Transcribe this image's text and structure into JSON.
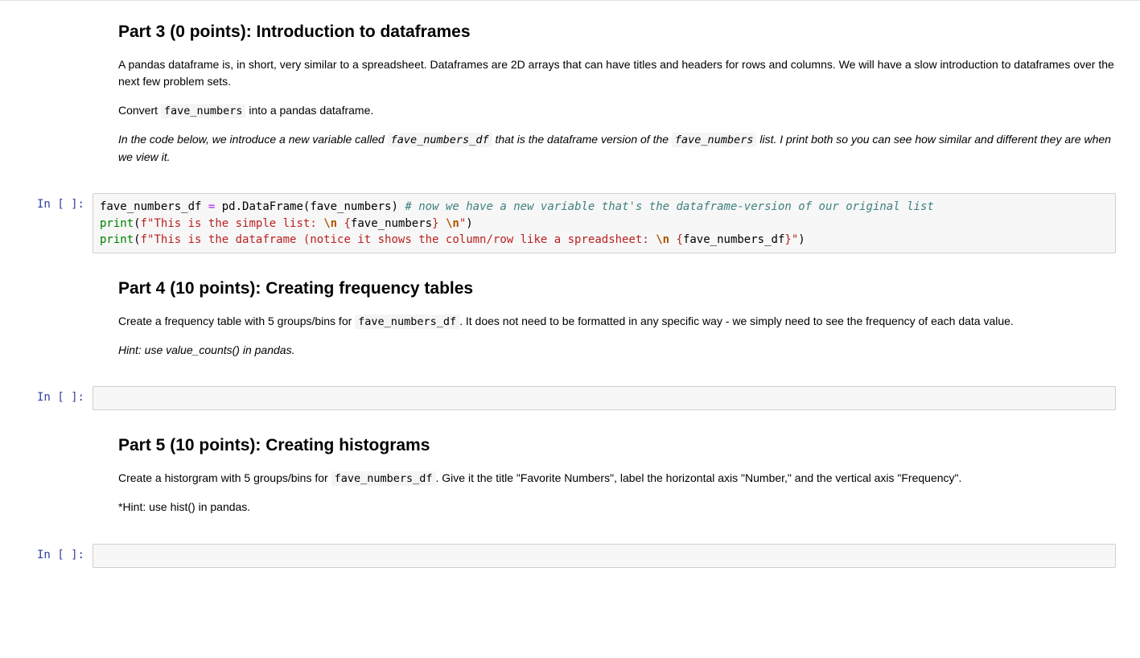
{
  "cells": {
    "part3": {
      "heading": "Part 3 (0 points): Introduction to dataframes",
      "para1": "A pandas dataframe is, in short, very similar to a spreadsheet. Dataframes are 2D arrays that can have titles and headers for rows and columns. We will have a slow introduction to dataframes over the next few problem sets.",
      "para2_pre": "Convert ",
      "para2_code": "fave_numbers",
      "para2_post": " into a pandas dataframe.",
      "para3_pre": "In the code below, we introduce a new variable called ",
      "para3_code1": "fave_numbers_df",
      "para3_mid": " that is the dataframe version of the ",
      "para3_code2": "fave_numbers",
      "para3_post": " list. I print both so you can see how similar and different they are when we view it."
    },
    "code1": {
      "prompt": "In [ ]:",
      "line1": {
        "var": "fave_numbers_df",
        "eq": " = ",
        "pd": "pd",
        "dot": ".",
        "fn": "DataFrame",
        "lp": "(",
        "arg": "fave_numbers",
        "rp": ")",
        "sp": " ",
        "comment": "# now we have a new variable that's the dataframe-version of our original list"
      },
      "line2": {
        "print": "print",
        "lp": "(",
        "f": "f",
        "q1": "\"",
        "s1": "This is the simple list: ",
        "esc1": "\\n",
        "s2": " ",
        "lb": "{",
        "interp": "fave_numbers",
        "rb": "}",
        "s3": " ",
        "esc2": "\\n",
        "q2": "\"",
        "rp": ")"
      },
      "line3": {
        "print": "print",
        "lp": "(",
        "f": "f",
        "q1": "\"",
        "s1": "This is the dataframe (notice it shows the column/row like a spreadsheet: ",
        "esc1": "\\n",
        "s2": " ",
        "lb": "{",
        "interp": "fave_numbers_df",
        "rb": "}",
        "q2": "\"",
        "rp": ")"
      }
    },
    "part4": {
      "heading": "Part 4 (10 points): Creating frequency tables",
      "para1_pre": "Create a frequency table with 5 groups/bins for ",
      "para1_code": "fave_numbers_df",
      "para1_post": ". It does not need to be formatted in any specific way - we simply need to see the frequency of each data value.",
      "hint": "Hint: use value_counts() in pandas."
    },
    "code2": {
      "prompt": "In [ ]:"
    },
    "part5": {
      "heading": "Part 5 (10 points): Creating histograms",
      "para1_pre": "Create a historgram with 5 groups/bins for ",
      "para1_code": "fave_numbers_df",
      "para1_post": ". Give it the title \"Favorite Numbers\", label the horizontal axis \"Number,\" and the vertical axis \"Frequency\".",
      "hint": "*Hint: use hist() in pandas."
    },
    "code3": {
      "prompt": "In [ ]:"
    }
  }
}
